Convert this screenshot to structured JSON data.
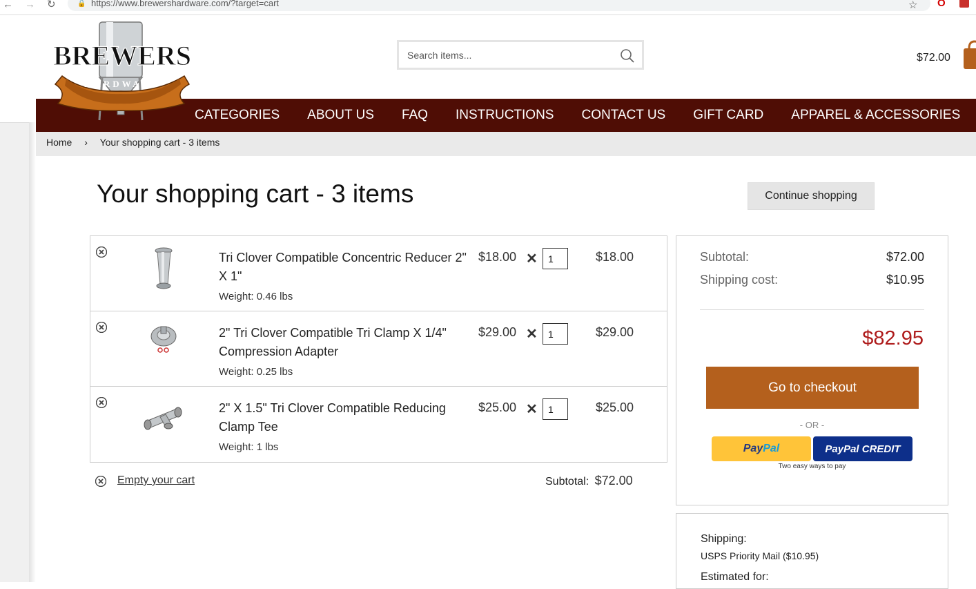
{
  "browser": {
    "url": "https://www.brewershardware.com/?target=cart"
  },
  "header": {
    "brand_main": "BREWERS",
    "brand_sub": "HARDWARE",
    "search_placeholder": "Search items...",
    "cart_total": "$72.00"
  },
  "nav": {
    "items": [
      "CATEGORIES",
      "ABOUT US",
      "FAQ",
      "INSTRUCTIONS",
      "CONTACT US",
      "GIFT CARD",
      "APPAREL & ACCESSORIES"
    ]
  },
  "breadcrumb": {
    "home": "Home",
    "separator": "›",
    "current": "Your shopping cart - 3 items"
  },
  "page": {
    "title": "Your shopping cart - 3 items",
    "continue_label": "Continue shopping"
  },
  "cart": {
    "items": [
      {
        "name": "Tri Clover Compatible Concentric Reducer 2\" X 1\"",
        "weight": "Weight: 0.46 lbs",
        "price": "$18.00",
        "qty": "1",
        "total": "$18.00"
      },
      {
        "name": "2\" Tri Clover Compatible Tri Clamp X 1/4\" Compression Adapter",
        "weight": "Weight: 0.25 lbs",
        "price": "$29.00",
        "qty": "1",
        "total": "$29.00"
      },
      {
        "name": "2\" X 1.5\" Tri Clover Compatible Reducing Clamp Tee",
        "weight": "Weight: 1 lbs",
        "price": "$25.00",
        "qty": "1",
        "total": "$25.00"
      }
    ],
    "times_symbol": "✕",
    "empty_label": "Empty your cart",
    "subtotal_label": "Subtotal:",
    "subtotal_value": "$72.00"
  },
  "summary": {
    "subtotal_label": "Subtotal:",
    "subtotal_value": "$72.00",
    "shipping_label": "Shipping cost:",
    "shipping_value": "$10.95",
    "grand_total": "$82.95",
    "checkout_label": "Go to checkout",
    "or_label": "- OR -",
    "paypal_a": "Pay",
    "paypal_b": "Pal",
    "paypal_credit": "PayPal CREDIT",
    "paypal_tagline": "Two easy ways to pay"
  },
  "shipping": {
    "label": "Shipping:",
    "method": "USPS Priority Mail ($10.95)",
    "estimated_label": "Estimated for:"
  },
  "colors": {
    "navbar": "#4f0d05",
    "checkout": "#b4601d",
    "grand_total": "#ae1b1b",
    "paypal_yellow": "#ffc439",
    "paypal_credit_blue": "#0d2f8a"
  }
}
